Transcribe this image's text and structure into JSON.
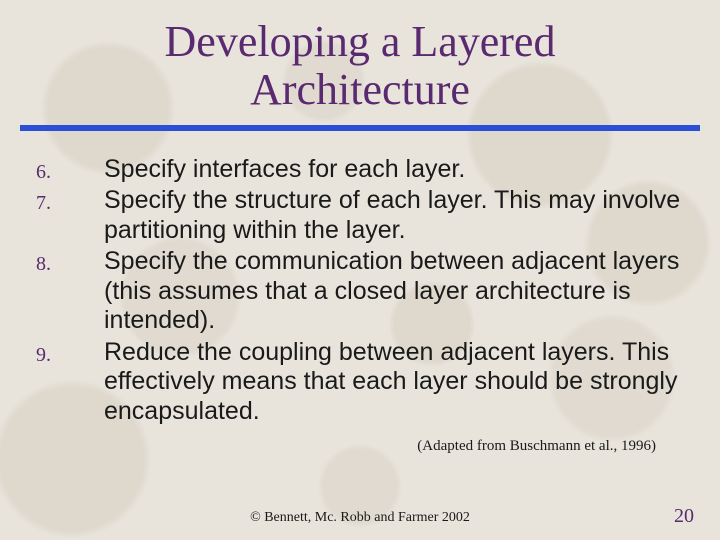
{
  "title_line1": "Developing a Layered",
  "title_line2": "Architecture",
  "items": [
    {
      "n": "6.",
      "text": "Specify interfaces for each layer."
    },
    {
      "n": "7.",
      "text": "Specify the structure of each layer.  This may involve partitioning within the layer."
    },
    {
      "n": "8.",
      "text": "Specify the communication between adjacent layers (this assumes that a closed layer architecture is intended)."
    },
    {
      "n": "9.",
      "text": "Reduce the coupling between adjacent layers.  This effectively means that each layer should be strongly encapsulated."
    }
  ],
  "attribution": "(Adapted from Buschmann et al., 1996)",
  "footer": "© Bennett, Mc. Robb and Farmer 2002",
  "page": "20"
}
